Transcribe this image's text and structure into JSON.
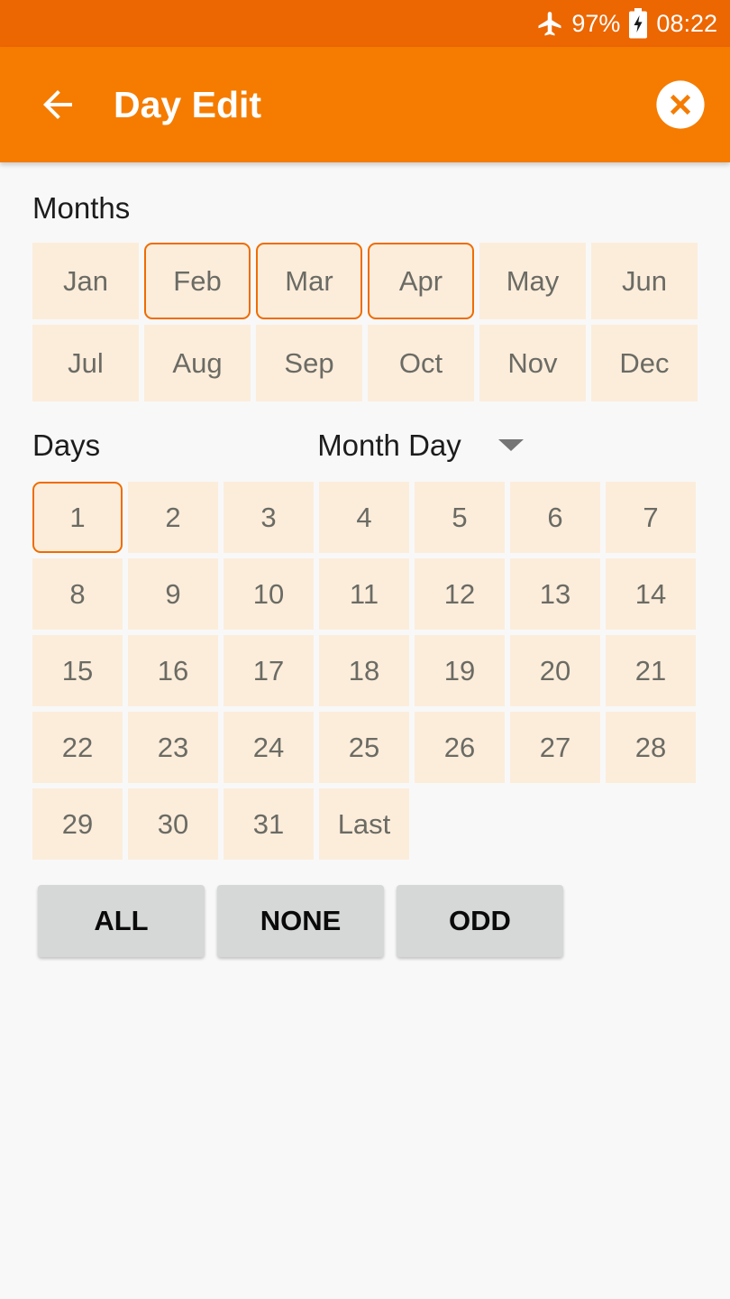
{
  "status_bar": {
    "airplane_icon": "airplane-mode-icon",
    "battery_percent": "97%",
    "battery_icon": "battery-charging-icon",
    "time": "08:22",
    "background_color": "#ec6602"
  },
  "app_bar": {
    "back_icon": "back-arrow-icon",
    "title": "Day Edit",
    "close_icon": "close-circle-icon",
    "background_color": "#f57c00"
  },
  "months_section": {
    "label": "Months",
    "tiles": [
      {
        "label": "Jan",
        "selected": false
      },
      {
        "label": "Feb",
        "selected": true
      },
      {
        "label": "Mar",
        "selected": true
      },
      {
        "label": "Apr",
        "selected": true
      },
      {
        "label": "May",
        "selected": false
      },
      {
        "label": "Jun",
        "selected": false
      },
      {
        "label": "Jul",
        "selected": false
      },
      {
        "label": "Aug",
        "selected": false
      },
      {
        "label": "Sep",
        "selected": false
      },
      {
        "label": "Oct",
        "selected": false
      },
      {
        "label": "Nov",
        "selected": false
      },
      {
        "label": "Dec",
        "selected": false
      }
    ]
  },
  "days_section": {
    "label": "Days",
    "mode_dropdown": {
      "value": "Month Day",
      "caret_icon": "chevron-down-icon"
    },
    "tiles": [
      {
        "label": "1",
        "selected": true
      },
      {
        "label": "2",
        "selected": false
      },
      {
        "label": "3",
        "selected": false
      },
      {
        "label": "4",
        "selected": false
      },
      {
        "label": "5",
        "selected": false
      },
      {
        "label": "6",
        "selected": false
      },
      {
        "label": "7",
        "selected": false
      },
      {
        "label": "8",
        "selected": false
      },
      {
        "label": "9",
        "selected": false
      },
      {
        "label": "10",
        "selected": false
      },
      {
        "label": "11",
        "selected": false
      },
      {
        "label": "12",
        "selected": false
      },
      {
        "label": "13",
        "selected": false
      },
      {
        "label": "14",
        "selected": false
      },
      {
        "label": "15",
        "selected": false
      },
      {
        "label": "16",
        "selected": false
      },
      {
        "label": "17",
        "selected": false
      },
      {
        "label": "18",
        "selected": false
      },
      {
        "label": "19",
        "selected": false
      },
      {
        "label": "20",
        "selected": false
      },
      {
        "label": "21",
        "selected": false
      },
      {
        "label": "22",
        "selected": false
      },
      {
        "label": "23",
        "selected": false
      },
      {
        "label": "24",
        "selected": false
      },
      {
        "label": "25",
        "selected": false
      },
      {
        "label": "26",
        "selected": false
      },
      {
        "label": "27",
        "selected": false
      },
      {
        "label": "28",
        "selected": false
      },
      {
        "label": "29",
        "selected": false
      },
      {
        "label": "30",
        "selected": false
      },
      {
        "label": "31",
        "selected": false
      },
      {
        "label": "Last",
        "selected": false
      }
    ]
  },
  "actions": [
    {
      "label": "ALL"
    },
    {
      "label": "NONE"
    },
    {
      "label": "ODD"
    }
  ],
  "colors": {
    "accent": "#ef6c00",
    "tile_fill": "#fceddb",
    "tile_text": "#6b6b64",
    "page_background": "#f8f8f8",
    "button_fill": "#d6d7d7"
  }
}
